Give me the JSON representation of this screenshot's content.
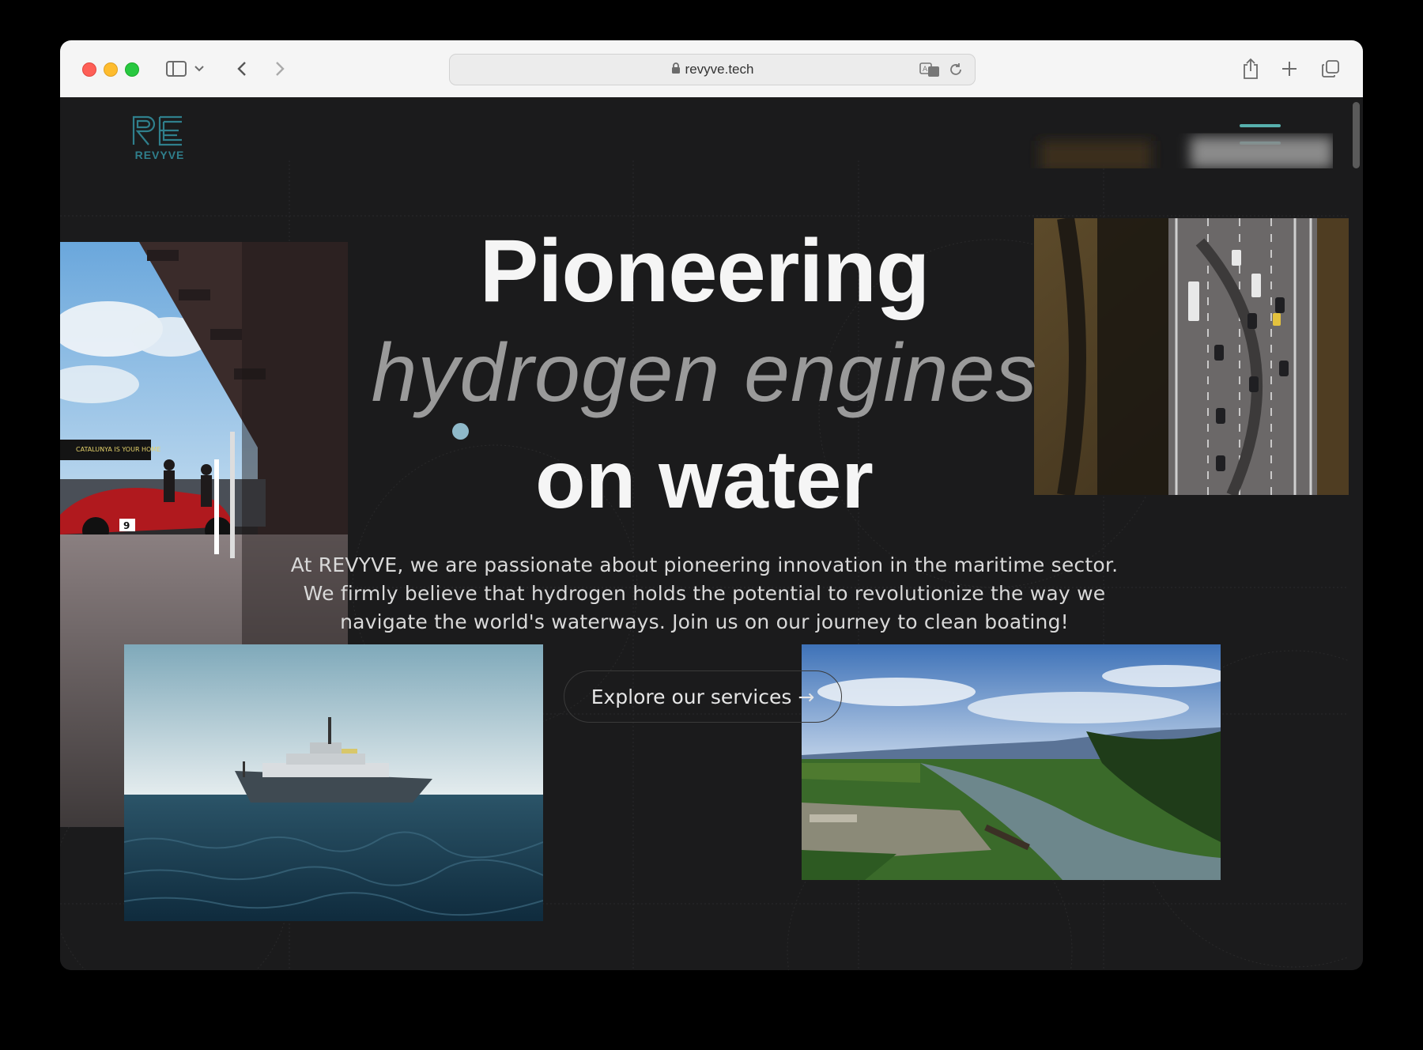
{
  "browser": {
    "url": "revyve.tech"
  },
  "site": {
    "logo_text": "REVYVE",
    "headline_line1": "Pioneering",
    "headline_line2": "hydrogen engines",
    "headline_line3": "on water",
    "intro": "At REVYVE, we are passionate about pioneering innovation in the maritime sector. We firmly believe that hydrogen holds the potential to revolutionize the way we navigate the world's waterways. Join us on our journey to clean boating!",
    "cta_label": "Explore our services →",
    "race_banner": "CATALUNYA IS YOUR HOME",
    "race_car_number": "9"
  },
  "colors": {
    "accent": "#57b0ad",
    "logo": "#2f7f8c",
    "background": "#1b1b1c"
  }
}
